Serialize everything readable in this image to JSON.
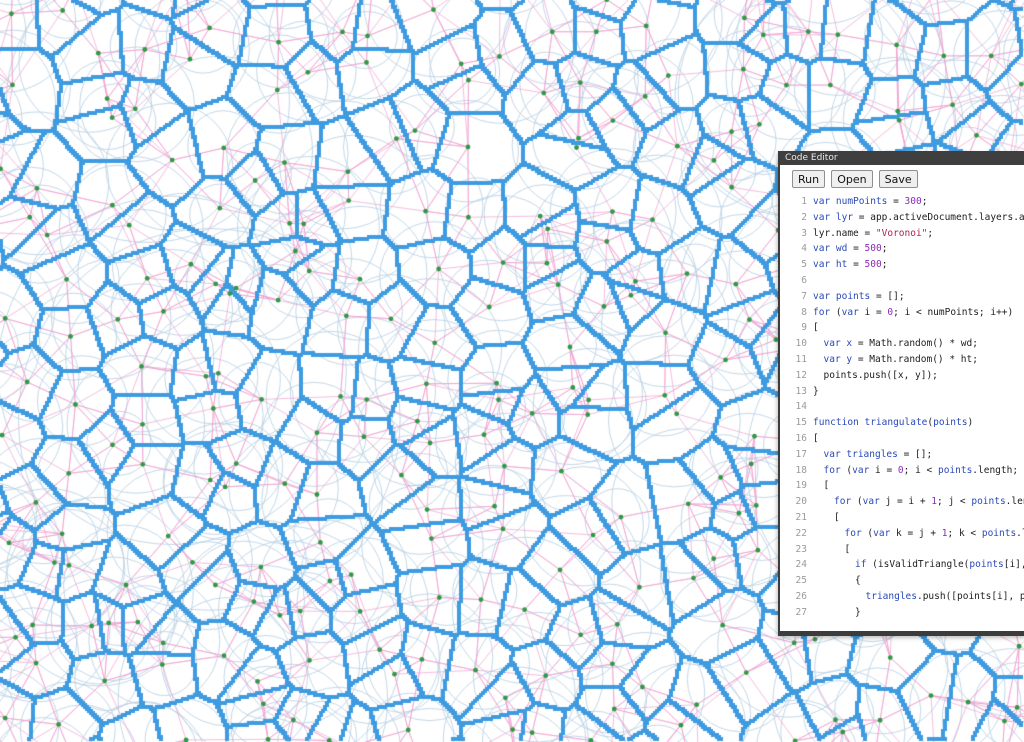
{
  "editor": {
    "title": "Code Editor",
    "buttons": {
      "run": "Run",
      "open": "Open",
      "save": "Save"
    },
    "lines": [
      {
        "n": "1",
        "indent": 0,
        "tokens": [
          [
            "kw",
            "var "
          ],
          [
            "id",
            "numPoints"
          ],
          [
            "plain",
            " = "
          ],
          [
            "num",
            "300"
          ],
          [
            "plain",
            ";"
          ]
        ]
      },
      {
        "n": "2",
        "indent": 0,
        "tokens": [
          [
            "kw",
            "var "
          ],
          [
            "id",
            "lyr"
          ],
          [
            "plain",
            " = app.activeDocument.layers.add("
          ]
        ]
      },
      {
        "n": "3",
        "indent": 0,
        "tokens": [
          [
            "plain",
            "lyr.name = "
          ],
          [
            "str",
            "\"Voronoi\""
          ],
          [
            "plain",
            ";"
          ]
        ]
      },
      {
        "n": "4",
        "indent": 0,
        "tokens": [
          [
            "kw",
            "var "
          ],
          [
            "id",
            "wd"
          ],
          [
            "plain",
            " = "
          ],
          [
            "num",
            "500"
          ],
          [
            "plain",
            ";"
          ]
        ]
      },
      {
        "n": "5",
        "indent": 0,
        "tokens": [
          [
            "kw",
            "var "
          ],
          [
            "id",
            "ht"
          ],
          [
            "plain",
            " = "
          ],
          [
            "num",
            "500"
          ],
          [
            "plain",
            ";"
          ]
        ]
      },
      {
        "n": "6",
        "indent": 0,
        "tokens": []
      },
      {
        "n": "7",
        "indent": 0,
        "tokens": [
          [
            "kw",
            "var "
          ],
          [
            "id",
            "points"
          ],
          [
            "plain",
            " = [];"
          ]
        ]
      },
      {
        "n": "8",
        "indent": 0,
        "tokens": [
          [
            "kw",
            "for "
          ],
          [
            "plain",
            "("
          ],
          [
            "kw",
            "var "
          ],
          [
            "plain",
            "i = "
          ],
          [
            "num",
            "0"
          ],
          [
            "plain",
            "; i < numPoints; i++)"
          ]
        ]
      },
      {
        "n": "9",
        "indent": 0,
        "tokens": [
          [
            "plain",
            "["
          ]
        ]
      },
      {
        "n": "10",
        "indent": 1,
        "tokens": [
          [
            "kw",
            "var "
          ],
          [
            "id",
            "x"
          ],
          [
            "plain",
            " = Math.random() * wd;"
          ]
        ]
      },
      {
        "n": "11",
        "indent": 1,
        "tokens": [
          [
            "kw",
            "var "
          ],
          [
            "id",
            "y"
          ],
          [
            "plain",
            " = Math.random() * ht;"
          ]
        ]
      },
      {
        "n": "12",
        "indent": 1,
        "tokens": [
          [
            "plain",
            "points.push([x, y]);"
          ]
        ]
      },
      {
        "n": "13",
        "indent": 0,
        "tokens": [
          [
            "plain",
            "}"
          ]
        ]
      },
      {
        "n": "14",
        "indent": 0,
        "tokens": []
      },
      {
        "n": "15",
        "indent": 0,
        "tokens": [
          [
            "kw",
            "function "
          ],
          [
            "id",
            "triangulate"
          ],
          [
            "plain",
            "("
          ],
          [
            "id",
            "points"
          ],
          [
            "plain",
            ")"
          ]
        ]
      },
      {
        "n": "16",
        "indent": 0,
        "tokens": [
          [
            "plain",
            "["
          ]
        ]
      },
      {
        "n": "17",
        "indent": 1,
        "tokens": [
          [
            "kw",
            "var "
          ],
          [
            "id",
            "triangles"
          ],
          [
            "plain",
            " = [];"
          ]
        ]
      },
      {
        "n": "18",
        "indent": 1,
        "tokens": [
          [
            "kw",
            "for "
          ],
          [
            "plain",
            "("
          ],
          [
            "kw",
            "var "
          ],
          [
            "plain",
            "i = "
          ],
          [
            "num",
            "0"
          ],
          [
            "plain",
            "; i < "
          ],
          [
            "id",
            "points"
          ],
          [
            "plain",
            ".length; i++"
          ]
        ]
      },
      {
        "n": "19",
        "indent": 1,
        "tokens": [
          [
            "plain",
            "["
          ]
        ]
      },
      {
        "n": "20",
        "indent": 2,
        "tokens": [
          [
            "kw",
            "for "
          ],
          [
            "plain",
            "("
          ],
          [
            "kw",
            "var "
          ],
          [
            "plain",
            "j = i + "
          ],
          [
            "num",
            "1"
          ],
          [
            "plain",
            "; j < "
          ],
          [
            "id",
            "points"
          ],
          [
            "plain",
            ".lengt"
          ]
        ]
      },
      {
        "n": "21",
        "indent": 2,
        "tokens": [
          [
            "plain",
            "["
          ]
        ]
      },
      {
        "n": "22",
        "indent": 3,
        "tokens": [
          [
            "kw",
            "for "
          ],
          [
            "plain",
            "("
          ],
          [
            "kw",
            "var "
          ],
          [
            "plain",
            "k = j + "
          ],
          [
            "num",
            "1"
          ],
          [
            "plain",
            "; k < "
          ],
          [
            "id",
            "points"
          ],
          [
            "plain",
            ".len"
          ]
        ]
      },
      {
        "n": "23",
        "indent": 3,
        "tokens": [
          [
            "plain",
            "["
          ]
        ]
      },
      {
        "n": "24",
        "indent": 4,
        "tokens": [
          [
            "kw",
            "if "
          ],
          [
            "plain",
            "(isValidTriangle("
          ],
          [
            "id",
            "points"
          ],
          [
            "plain",
            "[i], p"
          ]
        ]
      },
      {
        "n": "25",
        "indent": 4,
        "tokens": [
          [
            "plain",
            "{"
          ]
        ]
      },
      {
        "n": "26",
        "indent": 5,
        "tokens": [
          [
            "id",
            "triangles"
          ],
          [
            "plain",
            ".push([points[i], poi"
          ]
        ]
      },
      {
        "n": "27",
        "indent": 4,
        "tokens": [
          [
            "plain",
            "}"
          ]
        ]
      }
    ]
  },
  "colors": {
    "edge": "#3f9be0",
    "circle": "#b8d0e3",
    "delaunay": "#f0a0cf",
    "site": "#2e9a45",
    "background": "#ffffff"
  }
}
